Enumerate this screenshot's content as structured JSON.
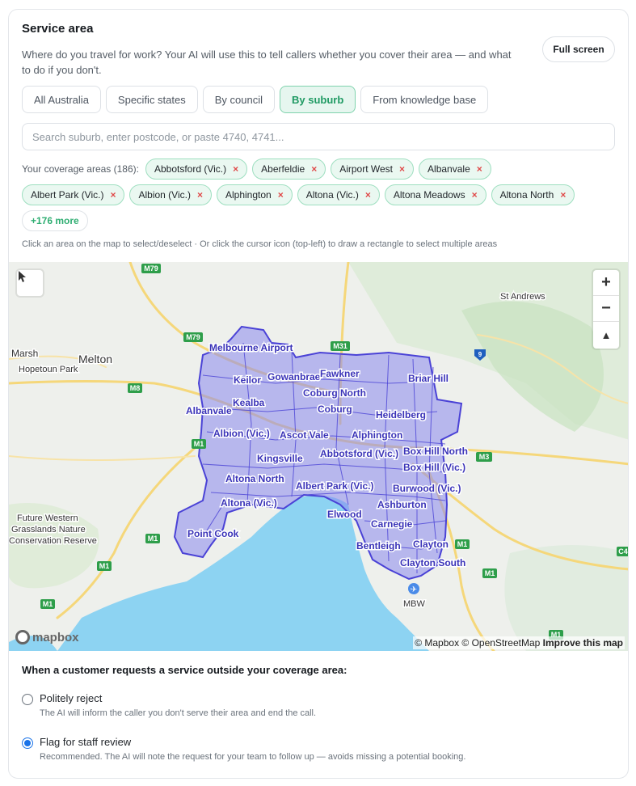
{
  "service_area": {
    "title": "Service area",
    "description": "Where do you travel for work? Your AI will use this to tell callers whether you cover their area — and what to do if you don't.",
    "full_screen_label": "Full screen",
    "tabs": [
      "All Australia",
      "Specific states",
      "By council",
      "By suburb",
      "From knowledge base"
    ],
    "active_tab": "By suburb",
    "search_placeholder": "Search suburb, enter postcode, or paste 4740, 4741...",
    "coverage_label": "Your coverage areas (186):",
    "chips": [
      "Abbotsford (Vic.)",
      "Aberfeldie",
      "Airport West",
      "Albanvale",
      "Albert Park (Vic.)",
      "Albion (Vic.)",
      "Alphington",
      "Altona (Vic.)",
      "Altona Meadows",
      "Altona North"
    ],
    "chip_remove": "×",
    "more_label": "+176 more",
    "hint": "Click an area on the map to select/deselect · Or click the cursor icon (top-left) to draw a rectangle to select multiple areas"
  },
  "map": {
    "labels": {
      "melbourne_airport": "Melbourne Airport",
      "keilor": "Keilor",
      "gowanbrae": "Gowanbrae",
      "fawkner": "Fawkner",
      "briar_hill": "Briar Hill",
      "kealba": "Kealba",
      "coburg_north": "Coburg North",
      "albanvale": "Albanvale",
      "coburg": "Coburg",
      "heidelberg": "Heidelberg",
      "albion": "Albion (Vic.)",
      "ascot_vale": "Ascot Vale",
      "alphington": "Alphington",
      "box_hill_north": "Box Hill North",
      "abbotsford": "Abbotsford (Vic.)",
      "kingsville": "Kingsville",
      "box_hill": "Box Hill (Vic.)",
      "altona_north": "Altona North",
      "albert_park": "Albert Park (Vic.)",
      "burwood": "Burwood (Vic.)",
      "altona": "Altona (Vic.)",
      "ashburton": "Ashburton",
      "elwood": "Elwood",
      "carnegie": "Carnegie",
      "point_cook": "Point Cook",
      "bentleigh": "Bentleigh",
      "clayton": "Clayton",
      "clayton_south": "Clayton South",
      "melton": "Melton",
      "marsh": "Marsh",
      "hopetoun_park": "Hopetoun Park",
      "st_andrews": "St Andrews",
      "future_western": "Future Western",
      "grasslands_nature": "Grasslands Nature",
      "conservation_reserve": "Conservation Reserve",
      "mbw": "MBW",
      "m79": "M79",
      "m31": "M31",
      "m8": "M8",
      "m1": "M1",
      "m3": "M3",
      "c4": "C4",
      "r9": "9"
    },
    "zoom_in": "+",
    "zoom_out": "−",
    "compass": "▲",
    "mapbox_logo": "mapbox",
    "attribution": "© Mapbox © OpenStreetMap",
    "improve": "Improve this map",
    "colors": {
      "coverage_fill": "#8b88ee",
      "coverage_stroke": "#4a42d6",
      "water": "#8dd3f2",
      "land": "#eef0ec",
      "road_motorway": "#f2c94c",
      "shield": "#2e9e4a"
    }
  },
  "outside_coverage": {
    "title": "When a customer requests a service outside your coverage area:",
    "options": [
      {
        "label": "Politely reject",
        "description": "The AI will inform the caller you don't serve their area and end the call.",
        "selected": false
      },
      {
        "label": "Flag for staff review",
        "description": "Recommended. The AI will note the request for your team to follow up — avoids missing a potential booking.",
        "selected": true
      }
    ]
  }
}
